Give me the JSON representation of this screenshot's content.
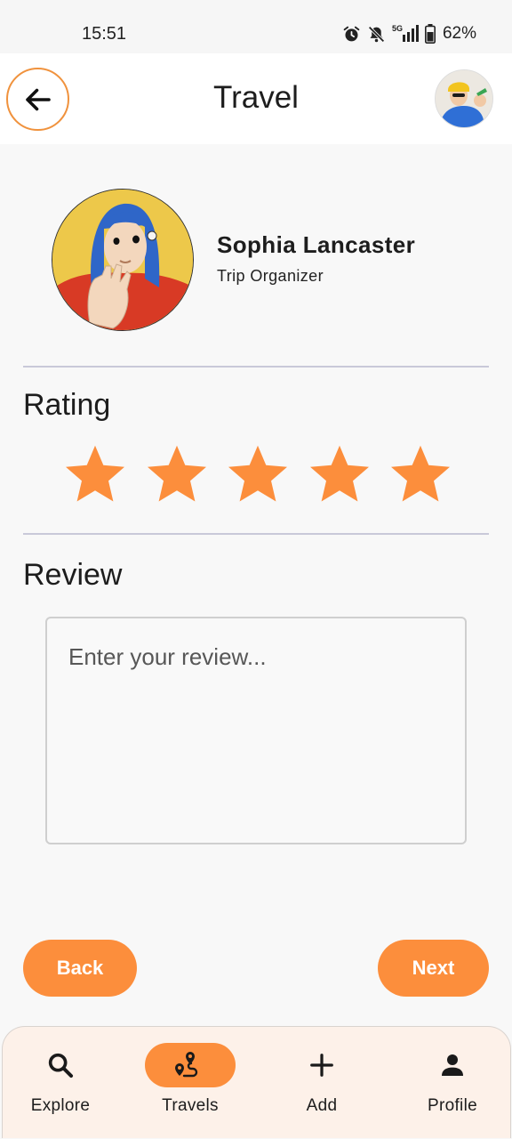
{
  "status_bar": {
    "time": "15:51",
    "network": "5G",
    "battery": "62%"
  },
  "header": {
    "title": "Travel",
    "back_icon": "arrow-left-icon"
  },
  "organizer": {
    "name": "Sophia Lancaster",
    "role": "Trip Organizer"
  },
  "rating": {
    "title": "Rating",
    "value": 5,
    "max": 5
  },
  "review": {
    "title": "Review",
    "placeholder": "Enter your review...",
    "value": ""
  },
  "actions": {
    "back_label": "Back",
    "next_label": "Next"
  },
  "bottom_nav": {
    "items": [
      {
        "label": "Explore",
        "icon": "search-icon",
        "active": false
      },
      {
        "label": "Travels",
        "icon": "route-icon",
        "active": true
      },
      {
        "label": "Add",
        "icon": "plus-icon",
        "active": false
      },
      {
        "label": "Profile",
        "icon": "person-icon",
        "active": false
      }
    ]
  },
  "colors": {
    "accent": "#fc8e3c",
    "star": "#fc8e3c",
    "nav_background": "#fdf1e9",
    "divider": "#c9c9d9"
  }
}
